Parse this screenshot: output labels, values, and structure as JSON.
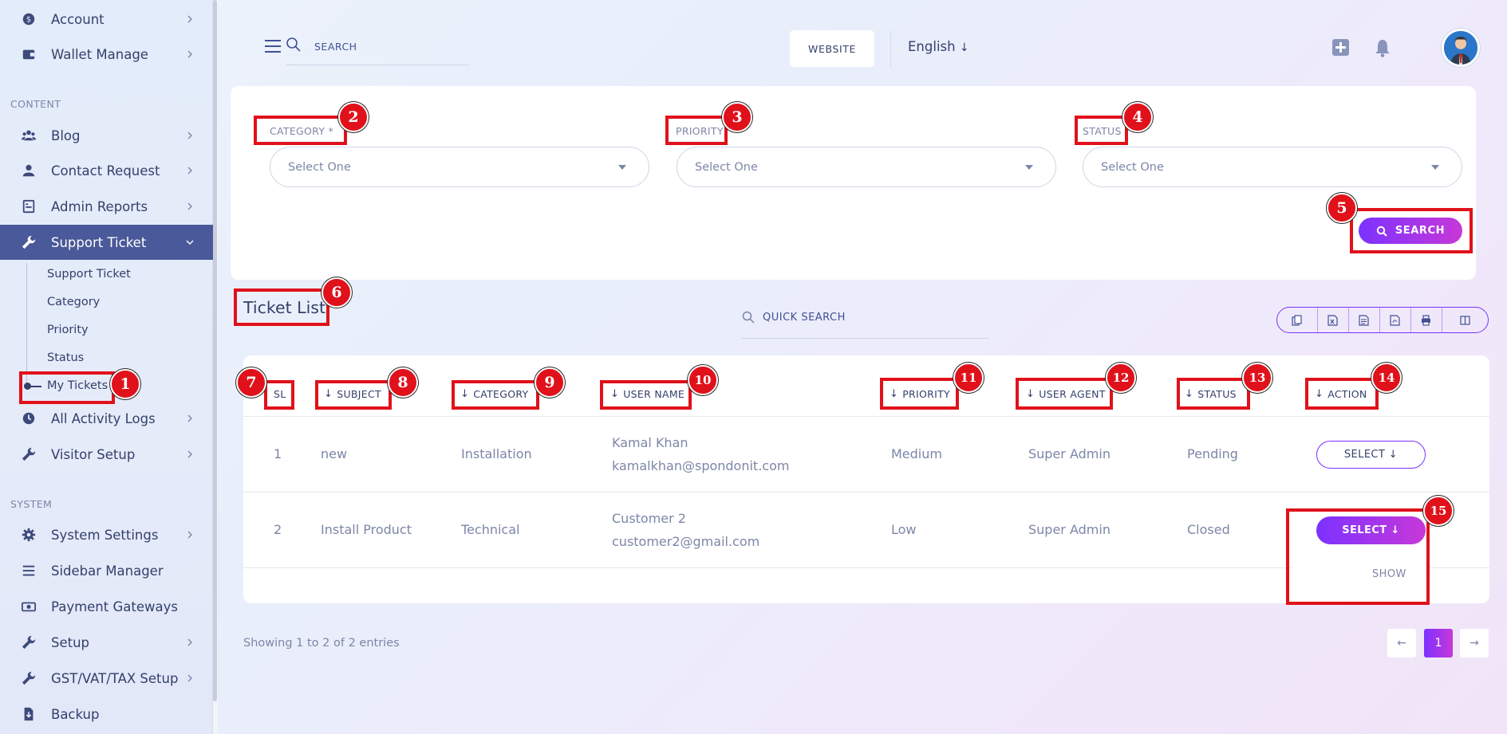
{
  "sidebar": {
    "items_top": [
      {
        "label": "Account",
        "icon": "dollar-icon"
      },
      {
        "label": "Wallet Manage",
        "icon": "wallet-icon"
      }
    ],
    "section_content": "CONTENT",
    "items_content": [
      {
        "label": "Blog",
        "icon": "users-icon"
      },
      {
        "label": "Contact Request",
        "icon": "user-icon"
      },
      {
        "label": "Admin Reports",
        "icon": "report-icon"
      },
      {
        "label": "Support Ticket",
        "icon": "wrench-icon"
      }
    ],
    "sub_items": [
      "Support Ticket",
      "Category",
      "Priority",
      "Status",
      "My Tickets"
    ],
    "items_after": [
      {
        "label": "All Activity Logs",
        "icon": "clock-icon"
      },
      {
        "label": "Visitor Setup",
        "icon": "wrench-icon"
      }
    ],
    "section_system": "SYSTEM",
    "items_system": [
      {
        "label": "System Settings",
        "icon": "gear-icon"
      },
      {
        "label": "Sidebar Manager",
        "icon": "list-icon"
      },
      {
        "label": "Payment Gateways",
        "icon": "money-icon"
      },
      {
        "label": "Setup",
        "icon": "wrench-icon"
      },
      {
        "label": "GST/VAT/TAX Setup",
        "icon": "wrench-icon"
      },
      {
        "label": "Backup",
        "icon": "download-icon"
      }
    ]
  },
  "header": {
    "search_placeholder": "SEARCH",
    "website_label": "WEBSITE",
    "language": "English"
  },
  "filters": {
    "category_label": "CATEGORY *",
    "priority_label": "PRIORITY",
    "status_label": "STATUS",
    "category_value": "Select One",
    "priority_value": "Select One",
    "status_value": "Select One",
    "search_button": "SEARCH"
  },
  "list": {
    "title": "Ticket List",
    "quick_search": "QUICK SEARCH",
    "columns": [
      "SL",
      "SUBJECT",
      "CATEGORY",
      "USER NAME",
      "PRIORITY",
      "USER AGENT",
      "STATUS",
      "ACTION"
    ],
    "rows": [
      {
        "sl": "1",
        "subject": "new",
        "category": "Installation",
        "user_name": "Kamal Khan",
        "user_email": "kamalkhan@spondonit.com",
        "priority": "Medium",
        "agent": "Super Admin",
        "status": "Pending",
        "action": "SELECT"
      },
      {
        "sl": "2",
        "subject": "Install Product",
        "category": "Technical",
        "user_name": "Customer 2",
        "user_email": "customer2@gmail.com",
        "priority": "Low",
        "agent": "Super Admin",
        "status": "Closed",
        "action": "SELECT"
      }
    ],
    "dropdown_item": "SHOW",
    "showing": "Showing 1 to 2 of 2 entries",
    "page": "1"
  },
  "annotations": [
    "1",
    "2",
    "3",
    "4",
    "5",
    "6",
    "7",
    "8",
    "9",
    "10",
    "11",
    "12",
    "13",
    "14",
    "15"
  ],
  "colors": {
    "accent": "#7c32ff",
    "accent2": "#c738d8",
    "annotation": "#e0111a",
    "active_sidebar": "#4a5999"
  }
}
